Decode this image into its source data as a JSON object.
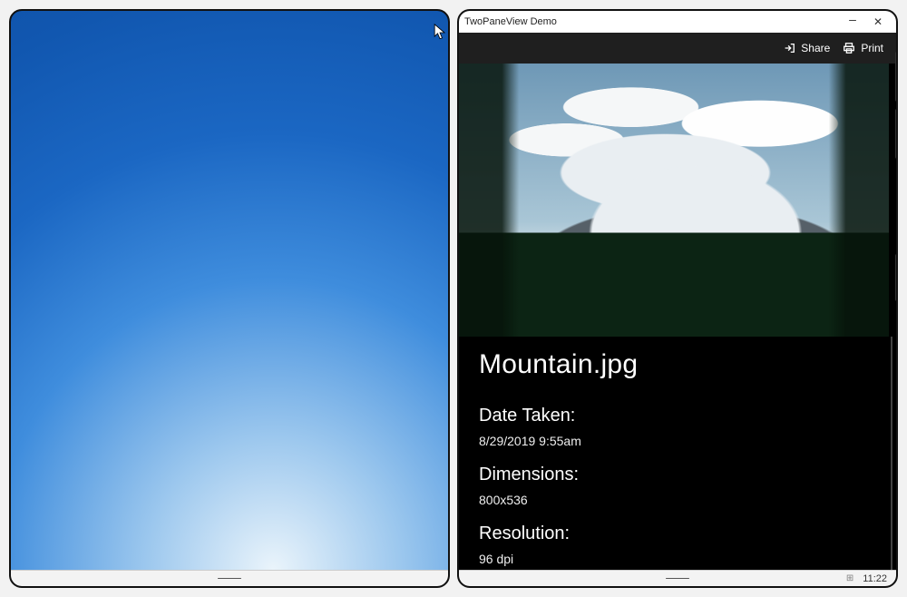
{
  "window": {
    "title": "TwoPaneView Demo",
    "minimize_label": "–",
    "close_label": "✕"
  },
  "commands": {
    "share": "Share",
    "print": "Print"
  },
  "file": {
    "name": "Mountain.jpg",
    "labels": {
      "date_taken": "Date Taken:",
      "dimensions": "Dimensions:",
      "resolution": "Resolution:"
    },
    "values": {
      "date_taken": "8/29/2019 9:55am",
      "dimensions": "800x536",
      "resolution": "96 dpi"
    }
  },
  "tray": {
    "clock": "11:22"
  }
}
